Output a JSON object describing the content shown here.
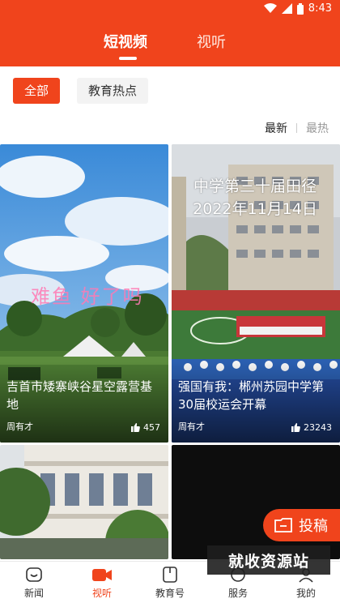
{
  "status_bar": {
    "time": "8:43"
  },
  "header": {
    "tabs": [
      {
        "label": "短视频",
        "active": true
      },
      {
        "label": "视听",
        "active": false
      }
    ]
  },
  "filters": {
    "chips": [
      {
        "label": "全部",
        "active": true
      },
      {
        "label": "教育热点",
        "active": false
      }
    ]
  },
  "sort": {
    "latest": "最新",
    "hottest": "最热"
  },
  "videos": [
    {
      "title": "吉首市矮寨峡谷星空露营基地",
      "author": "周有才",
      "likes": "457",
      "overlay_text": "难鱼 好了吗"
    },
    {
      "title": "强国有我：郴州苏园中学第30届校运会开幕",
      "author": "周有才",
      "likes": "23243",
      "overlay_line1": "中学第三十届田径",
      "overlay_line2": "2022年11月14日"
    }
  ],
  "contribute": {
    "label": "投稿"
  },
  "watermark": {
    "text": "就收资源站"
  },
  "tabbar": {
    "items": [
      {
        "label": "新闻",
        "icon": "news-icon",
        "active": false
      },
      {
        "label": "视听",
        "icon": "video-icon",
        "active": true
      },
      {
        "label": "教育号",
        "icon": "book-icon",
        "active": false
      },
      {
        "label": "服务",
        "icon": "service-icon",
        "active": false
      },
      {
        "label": "我的",
        "icon": "profile-icon",
        "active": false
      }
    ]
  },
  "colors": {
    "accent": "#f0441c"
  }
}
